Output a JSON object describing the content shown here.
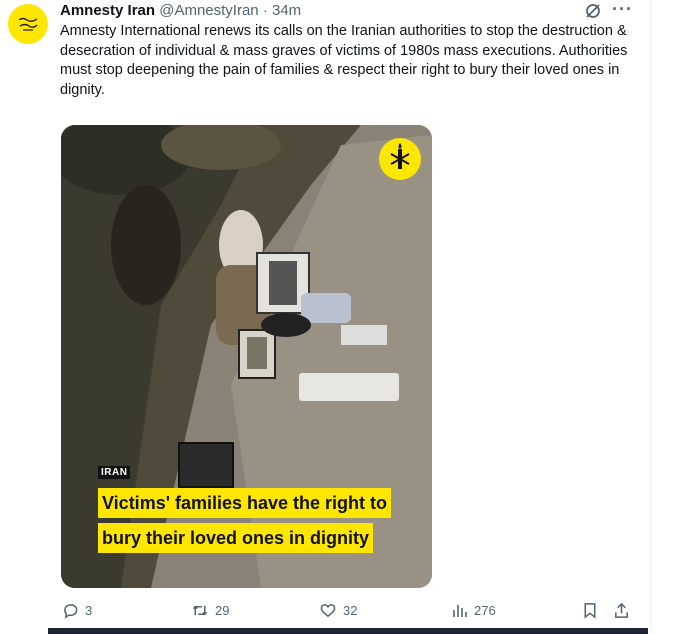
{
  "tweet": {
    "author_name": "Amnesty Iran",
    "author_handle": "@AmnestyIran",
    "separator": "·",
    "time_ago": "34m",
    "text": "Amnesty International renews its calls on the Iranian authorities to stop the destruction & desecration of individual & mass graves of victims of 1980s mass executions. Authorities must stop deepening the pain of families & respect their right to bury their loved ones in dignity.",
    "more_label": "···",
    "media": {
      "tag": "IRAN",
      "caption_line1": "Victims' families have the right to",
      "caption_line2": "bury their loved ones in dignity"
    },
    "metrics": {
      "replies": "3",
      "reposts": "29",
      "likes": "32",
      "views": "276"
    }
  },
  "colors": {
    "brand_yellow": "#ffe600",
    "text_primary": "#0f1419",
    "text_secondary": "#536471"
  },
  "icons": [
    "amnesty-candle-icon",
    "grok-icon",
    "more-icon",
    "reply-icon",
    "repost-icon",
    "like-icon",
    "views-icon",
    "bookmark-icon",
    "share-icon"
  ]
}
